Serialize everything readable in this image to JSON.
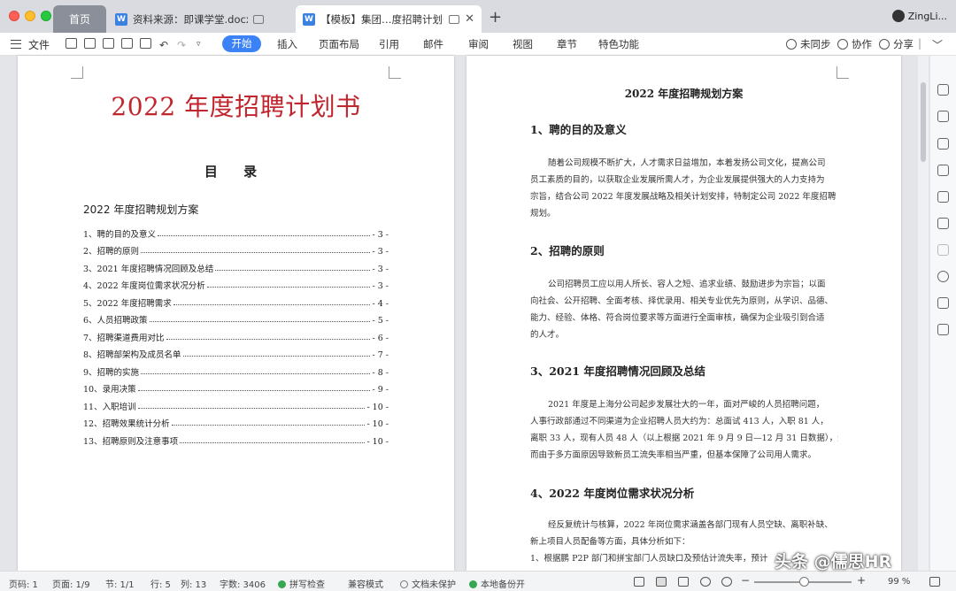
{
  "tabs": {
    "home": "首页",
    "doc1": "资料来源：即课学堂.docx",
    "doc2": "【模板】集团…度招聘计划书"
  },
  "user": {
    "name": "ZingLi..."
  },
  "menu": {
    "file": "文件",
    "items": [
      "开始",
      "插入",
      "页面布局",
      "引用",
      "邮件",
      "审阅",
      "视图",
      "章节",
      "特色功能"
    ],
    "sync": "未同步",
    "collab": "协作",
    "share": "分享"
  },
  "left_page": {
    "title": "2022 年度招聘计划书",
    "toc_heading": "目  录",
    "toc_sub": "2022 年度招聘规划方案",
    "toc": [
      {
        "label": "1、聘的目的及意义",
        "page": "- 3 -"
      },
      {
        "label": "2、招聘的原则",
        "page": "- 3 -"
      },
      {
        "label": "3、2021 年度招聘情况回顾及总结",
        "page": "- 3 -"
      },
      {
        "label": "4、2022 年度岗位需求状况分析",
        "page": "- 3 -"
      },
      {
        "label": "5、2022 年度招聘需求",
        "page": "- 4 -"
      },
      {
        "label": "6、人员招聘政策",
        "page": "- 5 -"
      },
      {
        "label": "7、招聘渠道费用对比",
        "page": "- 6 -"
      },
      {
        "label": "8、招聘部架构及成员名单",
        "page": "- 7 -"
      },
      {
        "label": "9、招聘的实施",
        "page": "- 8 -"
      },
      {
        "label": "10、录用决策",
        "page": "- 9 -"
      },
      {
        "label": "11、入职培训",
        "page": "- 10 -"
      },
      {
        "label": "12、招聘效果统计分析",
        "page": "- 10 -"
      },
      {
        "label": "13、招聘原则及注意事项",
        "page": "- 10 -"
      }
    ]
  },
  "right_page": {
    "title": "2022 年度招聘规划方案",
    "s1_head": "1、聘的目的及意义",
    "s1_lines": [
      "随着公司规模不断扩大，人才需求日益增加，本着发扬公司文化，提高公司",
      "员工素质的目的，以获取企业发展所需人才，为企业发展提供强大的人力支持为",
      "宗旨，结合公司 2022 年度发展战略及相关计划安排，特制定公司 2022 年度招聘",
      "规划。"
    ],
    "s2_head": "2、招聘的原则",
    "s2_lines": [
      "公司招聘员工应以用人所长、容人之短、追求业绩、鼓励进步为宗旨；以面",
      "向社会、公开招聘、全面考核、择优录用、相关专业优先为原则，从学识、品德、",
      "能力、经验、体格、符合岗位要求等方面进行全面审核，确保为企业吸引到合适",
      "的人才。"
    ],
    "s3_head": "3、2021 年度招聘情况回顾及总结",
    "s3_lines": [
      "2021 年度是上海分公司起步发展壮大的一年，面对严峻的人员招聘问题，",
      "人事行政部通过不同渠道为企业招聘人员大约为：总面试 413 人，入职 81 人，",
      "离职 33 人，现有人员 48 人（以上根据 2021 年 9 月 9 日—12 月 31 日数据），然",
      "而由于多方面原因导致新员工流失率相当严重，但基本保障了公司用人需求。"
    ],
    "s4_head": "4、2022 年度岗位需求状况分析",
    "s4_lines": [
      "经反复统计与核算，2022 年岗位需求涵盖各部门现有人员空缺、离职补缺、",
      "新上项目人员配备等方面，具体分析如下：",
      "1、根据鹏 P2P 部门和拼宝部门人员缺口及预估计流失率，预计"
    ]
  },
  "status": {
    "page_no": "页码: 1",
    "page_of": "页面: 1/9",
    "section": "节: 1/1",
    "row": "行: 5",
    "col": "列: 13",
    "words": "字数: 3406",
    "spell": "拼写检查",
    "compat": "兼容模式",
    "protect": "文档未保护",
    "backup": "本地备份开",
    "zoom": "99 %"
  },
  "watermark": "头条 @儒思HR"
}
